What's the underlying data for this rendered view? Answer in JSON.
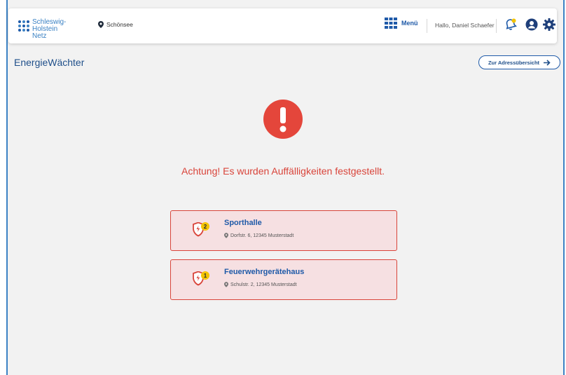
{
  "header": {
    "logo_line1": "Schleswig-Holstein",
    "logo_line2": "Netz",
    "location": "Schönsee",
    "menu_label": "Menü",
    "greeting": "Hallo, Daniel Schaefer"
  },
  "page": {
    "title": "EnergieWächter",
    "address_overview_button": "Zur Adressübersicht"
  },
  "alert": {
    "message": "Achtung! Es wurden Auffälligkeiten festgestellt."
  },
  "cards": [
    {
      "name": "Sporthalle",
      "address": "Dorfstr. 6, 12345 Musterstadt",
      "count": "2"
    },
    {
      "name": "Feuerwehrgerätehaus",
      "address": "Schulstr. 2, 12345 Musterstadt",
      "count": "1"
    }
  ],
  "colors": {
    "brand_blue": "#1f5aa8",
    "alert_red": "#d9443a",
    "card_bg": "#f6e0e2",
    "badge_yellow": "#f5c400"
  }
}
